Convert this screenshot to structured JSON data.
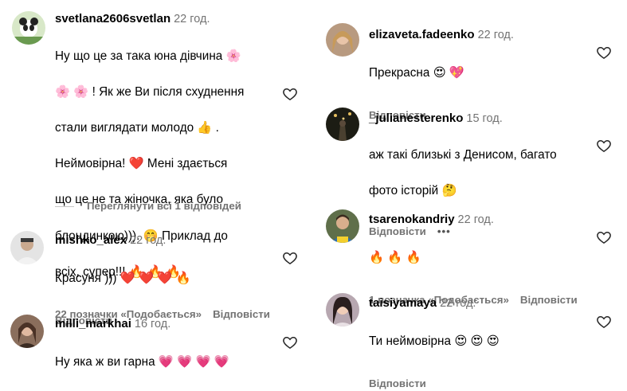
{
  "left": {
    "comments": [
      {
        "username": "svetlana2606svetlan",
        "time": "22 год.",
        "lines": [
          "Ну що це за така юна дівчина 🌸",
          "🌸 🌸 ! Як же Ви після схуднення",
          "стали виглядати молодо 👍 .",
          "Неймовірна! ❤️  Мені здається",
          "що це не та жіночка, яка було",
          "блондинкою))). 🤭  Приклад до",
          "всіх, супер!!!  🔥  🔥  🔥"
        ],
        "likes": "22 позначки «Подобається»",
        "reply": "Відповісти",
        "view_replies": "Переглянути всі 1 відповідей"
      },
      {
        "username": "mishko_alex",
        "time": "22 год.",
        "lines": [
          "Красуня ))) ❤️ ❤️ ❤️ 🔥"
        ],
        "reply": "Відповісти"
      },
      {
        "username": "milli_markhai",
        "time": "16 год.",
        "lines": [
          "Ну яка ж ви гарна  💗 💗 💗 💗"
        ]
      }
    ]
  },
  "right": {
    "comments": [
      {
        "username": "elizaveta.fadeenko",
        "time": "22 год.",
        "lines": [
          "Прекрасна 😍 💖"
        ],
        "reply": "Відповісти"
      },
      {
        "username": "_julianesterenko",
        "time": "15 год.",
        "lines": [
          "аж такі близькі з Денисом, багато",
          "фото історій 🤔"
        ],
        "reply": "Відповісти",
        "more": "•••"
      },
      {
        "username": "tsarenokandriy",
        "time": "22 год.",
        "lines": [
          "🔥  🔥  🔥"
        ],
        "likes": "1 позначка «Подобається»",
        "reply": "Відповісти"
      },
      {
        "username": "taisiyamaya",
        "time": "22 год.",
        "lines": [
          "Ти неймовірна 😍 😍 😍"
        ],
        "reply": "Відповісти"
      }
    ]
  },
  "colors": {
    "muted": "#737373",
    "text": "#000000",
    "line": "#c7c7c7"
  },
  "icons": {
    "like": "heart-outline-icon",
    "more": "more-horizontal-icon"
  }
}
